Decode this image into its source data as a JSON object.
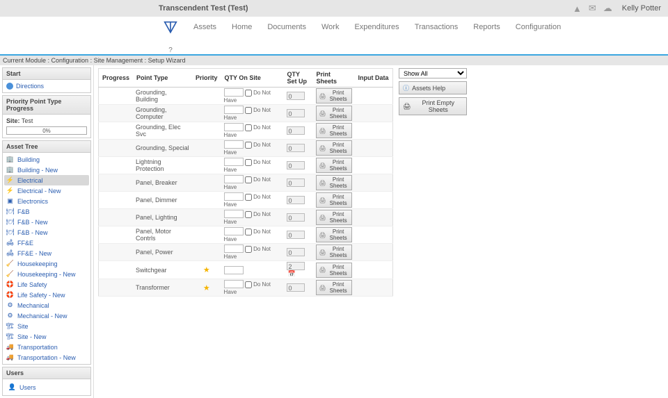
{
  "topbar": {
    "title": "Transcendent Test (Test)",
    "user": "Kelly Potter"
  },
  "nav": {
    "items": [
      "Assets",
      "Home",
      "Documents",
      "Work",
      "Expenditures",
      "Transactions",
      "Reports",
      "Configuration"
    ],
    "help": "?"
  },
  "breadcrumb": "Current Module : Configuration : Site Management : Setup Wizard",
  "panels": {
    "start": {
      "title": "Start",
      "directions": "Directions"
    },
    "ppt": {
      "title": "Priority Point Type Progress",
      "site_label": "Site:",
      "site_value": "Test",
      "percent": "0%"
    },
    "tree": {
      "title": "Asset Tree",
      "items": [
        {
          "label": "Building",
          "icon": "building"
        },
        {
          "label": "Building - New",
          "icon": "building"
        },
        {
          "label": "Electrical",
          "icon": "elec",
          "selected": true
        },
        {
          "label": "Electrical - New",
          "icon": "elec"
        },
        {
          "label": "Electronics",
          "icon": "chip"
        },
        {
          "label": "F&B",
          "icon": "fb"
        },
        {
          "label": "F&B - New",
          "icon": "fb"
        },
        {
          "label": "F&B - New",
          "icon": "fb"
        },
        {
          "label": "FF&E",
          "icon": "ffe"
        },
        {
          "label": "FF&E - New",
          "icon": "ffe"
        },
        {
          "label": "Housekeeping",
          "icon": "hk"
        },
        {
          "label": "Housekeeping - New",
          "icon": "hk"
        },
        {
          "label": "Life Safety",
          "icon": "ls"
        },
        {
          "label": "Life Safety - New",
          "icon": "ls"
        },
        {
          "label": "Mechanical",
          "icon": "mech"
        },
        {
          "label": "Mechanical - New",
          "icon": "mech"
        },
        {
          "label": "Site",
          "icon": "site"
        },
        {
          "label": "Site - New",
          "icon": "site"
        },
        {
          "label": "Transportation",
          "icon": "trans"
        },
        {
          "label": "Transportation - New",
          "icon": "trans"
        }
      ]
    },
    "users": {
      "title": "Users",
      "item": "Users"
    }
  },
  "grid": {
    "headers": {
      "progress": "Progress",
      "point_type": "Point Type",
      "priority": "Priority",
      "qty_on_site": "QTY On Site",
      "qty_set_up": "QTY Set Up",
      "print_sheets": "Print Sheets",
      "input_data": "Input Data"
    },
    "do_not_have": "Do Not Have",
    "print_label": "Print Sheets",
    "rows": [
      {
        "pt": "Grounding, Building",
        "qsu": "0",
        "dnh": true
      },
      {
        "pt": "Grounding, Computer",
        "qsu": "0",
        "dnh": true
      },
      {
        "pt": "Grounding, Elec Svc",
        "qsu": "0",
        "dnh": true
      },
      {
        "pt": "Grounding, Special",
        "qsu": "0",
        "dnh": true
      },
      {
        "pt": "Lightning Protection",
        "qsu": "0",
        "dnh": true
      },
      {
        "pt": "Panel, Breaker",
        "qsu": "0",
        "dnh": true
      },
      {
        "pt": "Panel, Dimmer",
        "qsu": "0",
        "dnh": true
      },
      {
        "pt": "Panel, Lighting",
        "qsu": "0",
        "dnh": true
      },
      {
        "pt": "Panel, Motor Contrls",
        "qsu": "0",
        "dnh": true
      },
      {
        "pt": "Panel, Power",
        "qsu": "0",
        "dnh": true
      },
      {
        "pt": "Switchgear",
        "qsu": "2",
        "star": true,
        "dnh": false,
        "cal": true
      },
      {
        "pt": "Transformer",
        "qsu": "0",
        "star": true,
        "dnh": true
      }
    ]
  },
  "right": {
    "dropdown": "Show All",
    "assets_help": "Assets Help",
    "print_empty": "Print Empty Sheets"
  }
}
